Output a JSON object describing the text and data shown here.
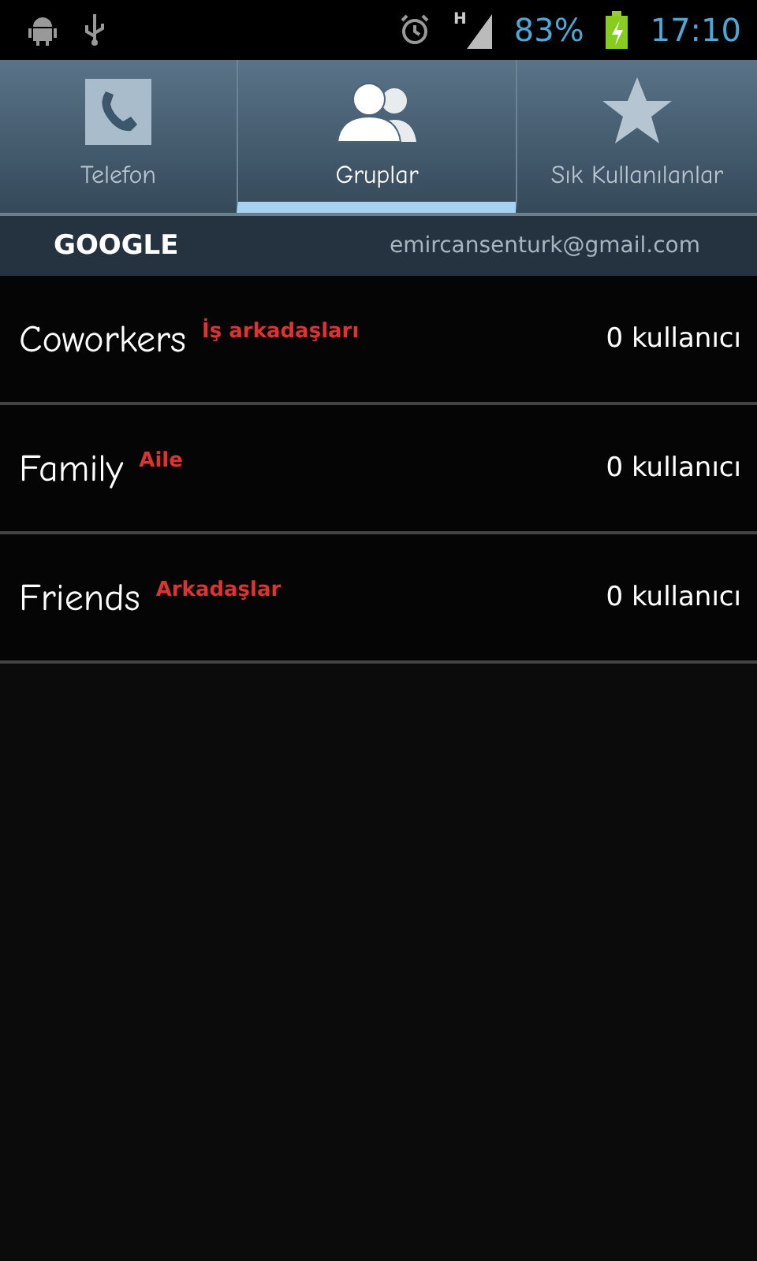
{
  "status_bar": {
    "network_type": "H",
    "battery": "83%",
    "time": "17:10"
  },
  "tabs": [
    {
      "label": "Telefon",
      "kind": "phone",
      "selected": false
    },
    {
      "label": "Gruplar",
      "kind": "groups",
      "selected": true
    },
    {
      "label": "Sık Kullanılanlar",
      "kind": "favorites",
      "selected": false
    }
  ],
  "account": {
    "type": "GOOGLE",
    "email": "emircansenturk@gmail.com"
  },
  "groups": [
    {
      "name": "Coworkers",
      "annotation": "İş arkadaşları",
      "count": "0 kullanıcı"
    },
    {
      "name": "Family",
      "annotation": "Aile",
      "count": "0 kullanıcı"
    },
    {
      "name": "Friends",
      "annotation": "Arkadaşlar",
      "count": "0 kullanıcı"
    }
  ]
}
